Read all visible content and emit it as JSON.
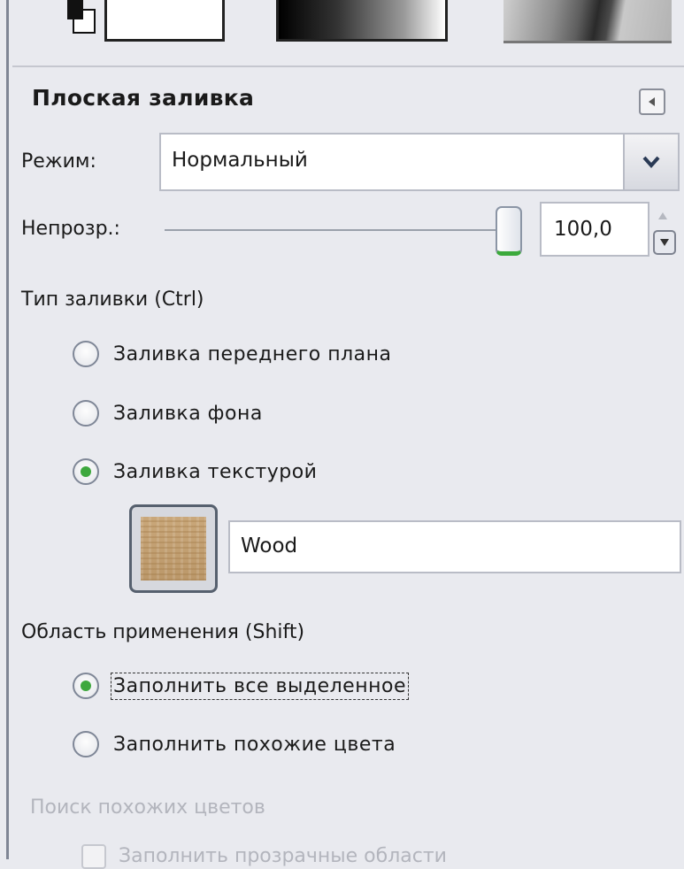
{
  "panel": {
    "title": "Плоская заливка",
    "collapse_icon": "triangle-left-icon"
  },
  "mode": {
    "label": "Режим:",
    "value": "Нормальный"
  },
  "opacity": {
    "label": "Непрозр.:",
    "value": "100,0",
    "level_percent": 100
  },
  "fill_type": {
    "label": "Тип заливки (Ctrl)",
    "options": [
      {
        "label": "Заливка переднего плана",
        "selected": false
      },
      {
        "label": "Заливка фона",
        "selected": false
      },
      {
        "label": "Заливка текстурой",
        "selected": true
      }
    ],
    "pattern_name": "Wood"
  },
  "affected_area": {
    "label": "Область применения (Shift)",
    "options": [
      {
        "label": "Заполнить все выделенное",
        "selected": true
      },
      {
        "label": "Заполнить похожие цвета",
        "selected": false
      }
    ]
  },
  "similar_colors": {
    "label": "Поиск похожих цветов",
    "checkbox_label": "Заполнить прозрачные области"
  },
  "colors": {
    "accent": "#3ea83e",
    "background": "#e9eaef"
  }
}
